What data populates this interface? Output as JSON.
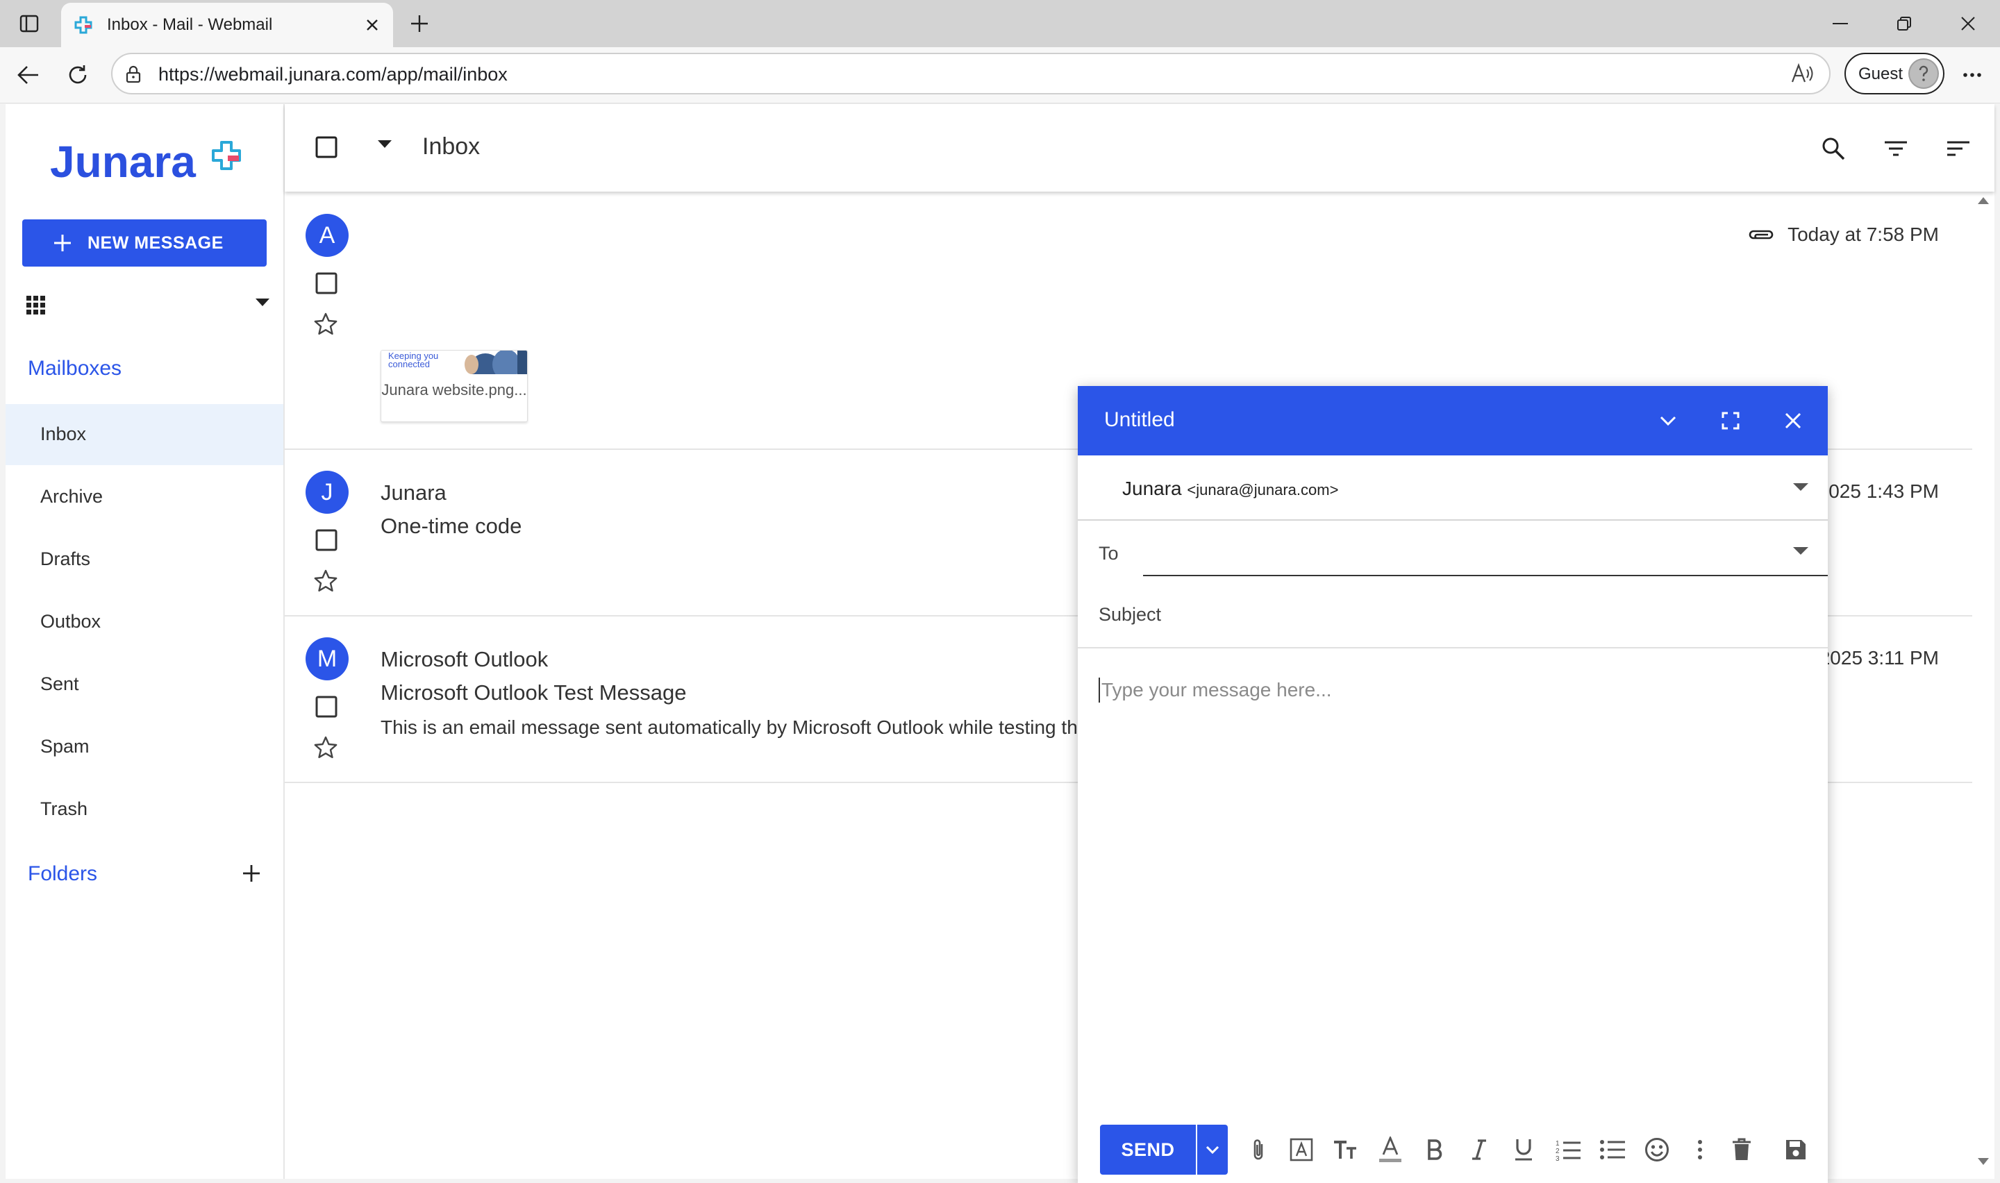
{
  "browser": {
    "tab_title": "Inbox - Mail - Webmail",
    "url": "https://webmail.junara.com/app/mail/inbox",
    "profile_label": "Guest"
  },
  "sidebar": {
    "logo_text": "Junara",
    "new_message_label": "NEW MESSAGE",
    "mailboxes_title": "Mailboxes",
    "mailboxes": [
      {
        "label": "Inbox"
      },
      {
        "label": "Archive"
      },
      {
        "label": "Drafts"
      },
      {
        "label": "Outbox"
      },
      {
        "label": "Sent"
      },
      {
        "label": "Spam"
      },
      {
        "label": "Trash"
      }
    ],
    "folders_title": "Folders"
  },
  "toolbar": {
    "title": "Inbox"
  },
  "messages": [
    {
      "avatar": "A",
      "sender": "",
      "subject": "",
      "preview": "",
      "date": "Today at 7:58 PM",
      "attachment_name": "Junara website.png...",
      "attachment_caption": "Keeping you connected"
    },
    {
      "avatar": "J",
      "sender": "Junara",
      "subject": "One-time code",
      "preview": "",
      "date": "2025 1:43 PM"
    },
    {
      "avatar": "M",
      "sender": "Microsoft Outlook",
      "subject": "Microsoft Outlook Test Message",
      "preview": "This is an email message sent automatically by Microsoft Outlook while testing th",
      "date": "2025 3:11 PM"
    }
  ],
  "compose": {
    "title": "Untitled",
    "from_name": "Junara",
    "from_email": "<junara@junara.com>",
    "to_label": "To",
    "subject_label": "Subject",
    "body_placeholder": "Type your message here...",
    "send_label": "SEND"
  },
  "colors": {
    "accent": "#2b55e8",
    "logo": "#2b50df",
    "active_item_bg": "#eaf2fc"
  }
}
